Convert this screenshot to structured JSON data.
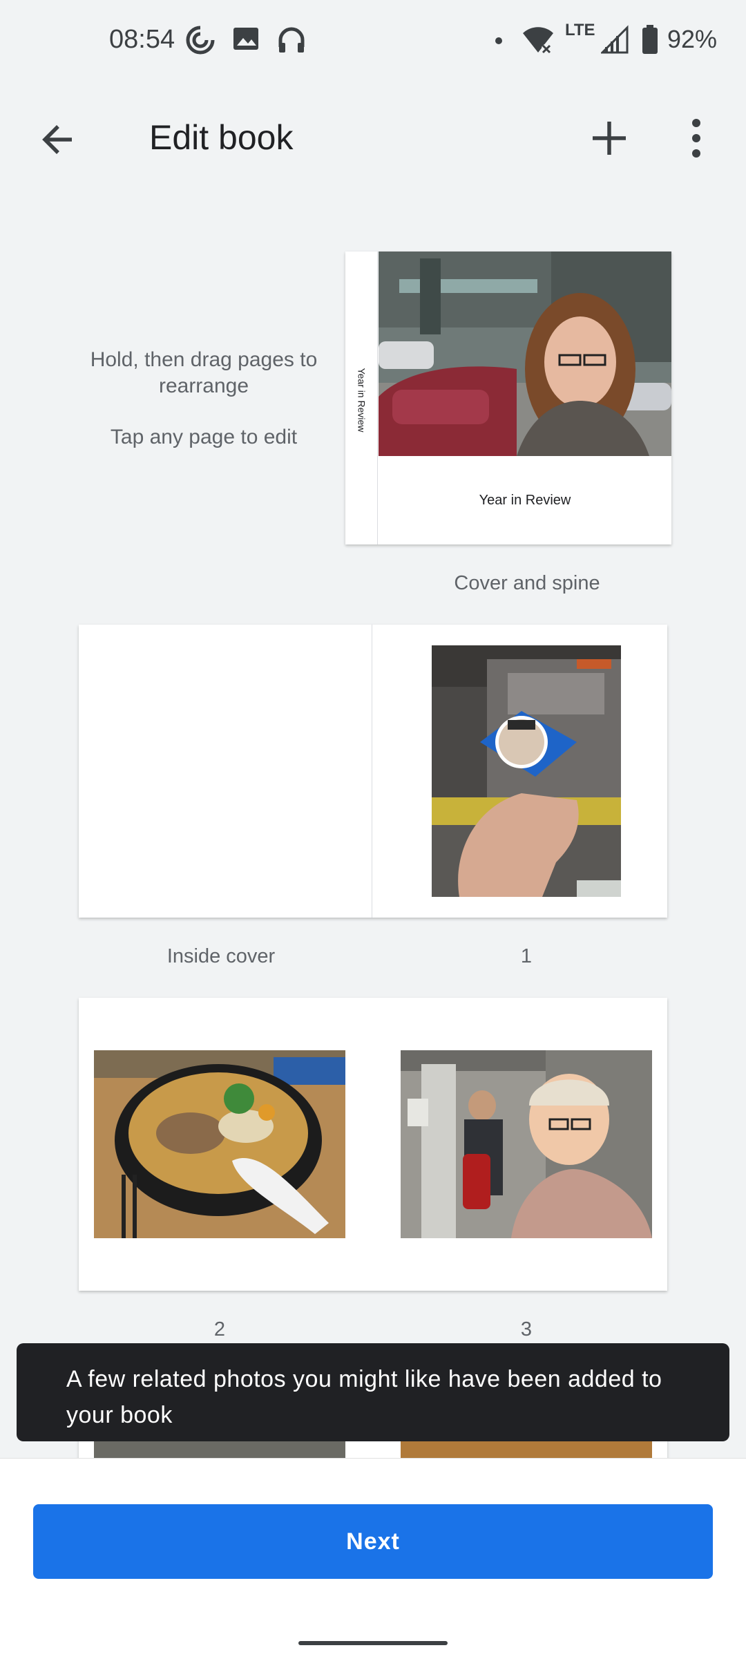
{
  "status_bar": {
    "time": "08:54",
    "network": "LTE",
    "battery": "92%"
  },
  "app_bar": {
    "title": "Edit book"
  },
  "hints": {
    "line1": "Hold, then drag pages to rearrange",
    "line2": "Tap any page to edit"
  },
  "cover": {
    "spine_text": "Year in Review",
    "cover_title": "Year in Review",
    "caption": "Cover and spine"
  },
  "spreads": [
    {
      "left_caption": "Inside cover",
      "right_caption": "1"
    },
    {
      "left_caption": "2",
      "right_caption": "3"
    }
  ],
  "snackbar": {
    "message": "A few related photos you might like have been added to your book"
  },
  "footer": {
    "next_label": "Next"
  },
  "colors": {
    "accent": "#1a73e8",
    "snackbar_bg": "#202124",
    "background": "#f1f3f4"
  }
}
